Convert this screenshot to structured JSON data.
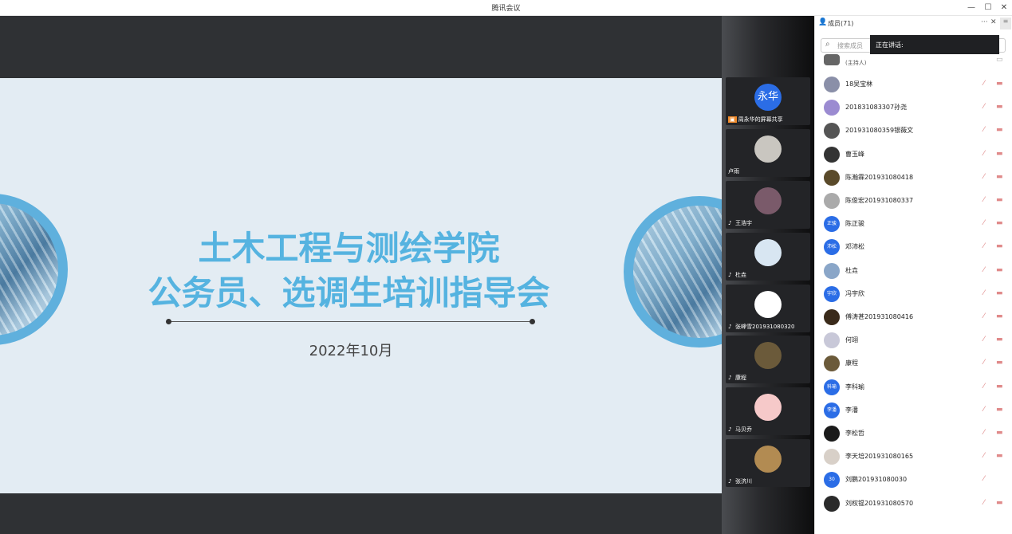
{
  "window": {
    "title": "腾讯会议",
    "minimize": "—",
    "maximize": "☐",
    "close": "✕"
  },
  "slide": {
    "title_line1": "土木工程与测绘学院",
    "title_line2": "公务员、选调生培训指导会",
    "date": "2022年10月"
  },
  "video_tiles": [
    {
      "name": "周永华的屏幕共享",
      "avatar_text": "永华",
      "avatar_color": "#2b6de6",
      "sharing": true
    },
    {
      "name": "卢雨",
      "avatar_color": "#c9c6c0"
    },
    {
      "name": "王浩宇",
      "avatar_color": "#7a5a6a"
    },
    {
      "name": "杜垚",
      "avatar_color": "#d8e6f2"
    },
    {
      "name": "张峰雪201931080320",
      "avatar_color": "#ffffff"
    },
    {
      "name": "康程",
      "avatar_color": "#6b5a3a"
    },
    {
      "name": "马贝乔",
      "avatar_color": "#f6c9c9"
    },
    {
      "name": "张济川",
      "avatar_color": "#b28b52"
    }
  ],
  "panel": {
    "title": "成员(71)",
    "more": "···",
    "close": "✕",
    "search_placeholder": "搜索成员",
    "speaking_label": "正在讲话:",
    "host_partial": "(主持人)",
    "members": [
      {
        "name": "18吴宝林",
        "avatar_color": "#8a8fa8"
      },
      {
        "name": "201831083307孙尧",
        "avatar_color": "#9b8bd1"
      },
      {
        "name": "201931080359银薇文",
        "avatar_color": "#555"
      },
      {
        "name": "曹玉峰",
        "avatar_color": "#333"
      },
      {
        "name": "陈瀚霖201931080418",
        "avatar_color": "#5a4a2a"
      },
      {
        "name": "陈俊宏201931080337",
        "avatar_color": "#aaa"
      },
      {
        "name": "陈正骏",
        "avatar_text": "正骏",
        "avatar_color": "#2b6de6"
      },
      {
        "name": "邓沛松",
        "avatar_text": "沛松",
        "avatar_color": "#2b6de6"
      },
      {
        "name": "杜垚",
        "avatar_color": "#8aa6c8"
      },
      {
        "name": "冯宇欣",
        "avatar_text": "宇欣",
        "avatar_color": "#2b6de6"
      },
      {
        "name": "傅涛甚201931080416",
        "avatar_color": "#3a2a1a"
      },
      {
        "name": "何翊",
        "avatar_color": "#c8c8d8"
      },
      {
        "name": "康程",
        "avatar_color": "#6b5a3a"
      },
      {
        "name": "李科瑜",
        "avatar_text": "科瑜",
        "avatar_color": "#2b6de6"
      },
      {
        "name": "李潘",
        "avatar_text": "李潘",
        "avatar_color": "#2b6de6"
      },
      {
        "name": "李松哲",
        "avatar_color": "#1a1a1a"
      },
      {
        "name": "李天培201931080165",
        "avatar_color": "#d8d0c8"
      },
      {
        "name": "刘鹏201931080030",
        "avatar_text": "30",
        "avatar_color": "#2b6de6"
      },
      {
        "name": "刘权锟201931080570",
        "avatar_color": "#2a2a2a"
      }
    ]
  }
}
